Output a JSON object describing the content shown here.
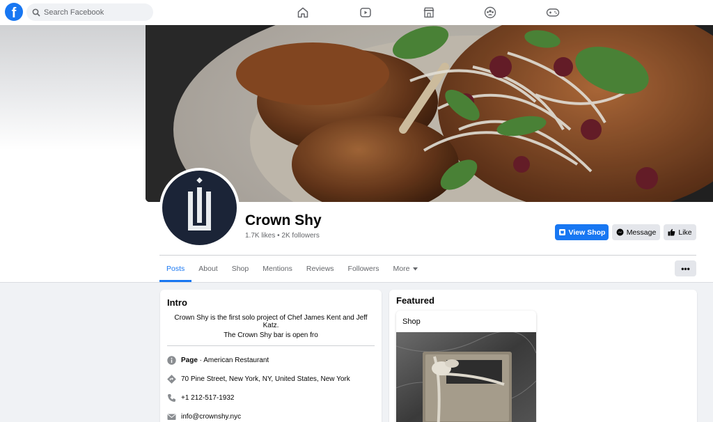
{
  "header": {
    "search_placeholder": "Search Facebook",
    "nav_icons": [
      "home-icon",
      "watch-icon",
      "marketplace-icon",
      "groups-icon",
      "gaming-icon"
    ]
  },
  "colors": {
    "brand_blue": "#1877f2",
    "page_bg": "#f0f2f5",
    "avatar_bg": "#1b2437"
  },
  "profile": {
    "name": "Crown Shy",
    "stats": "1.7K likes • 2K followers",
    "buttons": {
      "view_shop": "View Shop",
      "message": "Message",
      "like": "Like"
    }
  },
  "tabs": [
    {
      "label": "Posts",
      "active": true
    },
    {
      "label": "About"
    },
    {
      "label": "Shop"
    },
    {
      "label": "Mentions"
    },
    {
      "label": "Reviews"
    },
    {
      "label": "Followers"
    },
    {
      "label": "More"
    }
  ],
  "more_button": "•••",
  "intro": {
    "title": "Intro",
    "bio": "Crown Shy is the first solo project of Chef James Kent and Jeff Katz.",
    "bar_text": "The Crown Shy bar is open fro",
    "page_type_bold": "Page",
    "page_type_rest": " · American Restaurant",
    "address": "70 Pine Street, New York, NY, United States, New York",
    "phone": "+1 212-517-1932",
    "email": "info@crownshy.nyc"
  },
  "featured": {
    "title": "Featured",
    "card_label": "Shop"
  }
}
